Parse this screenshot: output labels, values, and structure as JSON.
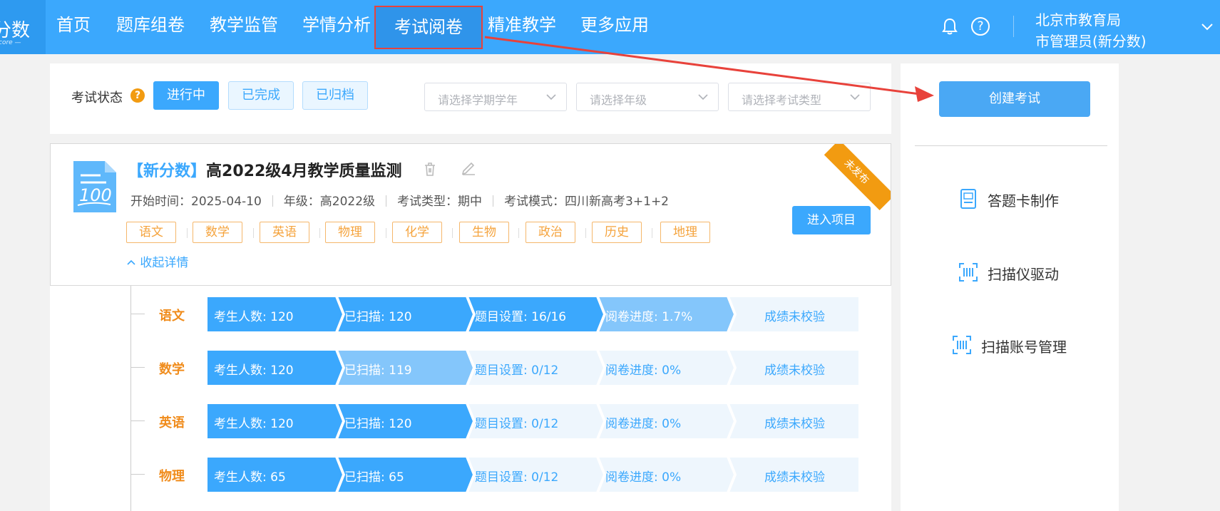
{
  "logo": {
    "text": "分数",
    "sub": "core —"
  },
  "nav": {
    "items": [
      "首页",
      "题库组卷",
      "教学监管",
      "学情分析",
      "考试阅卷",
      "精准教学",
      "更多应用"
    ],
    "active_index": 4,
    "user_org": "北京市教育局",
    "user_role": "市管理员(新分数)"
  },
  "filter": {
    "status_label": "考试状态",
    "help_glyph": "?",
    "buttons": [
      "进行中",
      "已完成",
      "已归档"
    ],
    "active_button": 0,
    "selects": [
      "请选择学期学年",
      "请选择年级",
      "请选择考试类型"
    ]
  },
  "right_panel": {
    "create_label": "创建考试",
    "tools": [
      "答题卡制作",
      "扫描仪驱动",
      "扫描账号管理"
    ]
  },
  "exam": {
    "tag": "【新分数】",
    "title": "高2022级4月教学质量监测",
    "ribbon": "未发布",
    "meta": {
      "start": "开始时间：2025-04-10",
      "grade": "年级：高2022级",
      "type": "考试类型：期中",
      "mode": "考试模式：四川新高考3+1+2"
    },
    "subjects": [
      "语文",
      "数学",
      "英语",
      "物理",
      "化学",
      "生物",
      "政治",
      "历史",
      "地理"
    ],
    "collapse_label": "收起详情",
    "enter_label": "进入项目"
  },
  "progress_rows": [
    {
      "subject": "语文",
      "cells": [
        "考生人数: 120",
        "已扫描: 120",
        "题目设置: 16/16",
        "阅卷进度: 1.7%",
        "成绩未校验"
      ],
      "states": [
        "full",
        "full",
        "full",
        "partial",
        "empty"
      ]
    },
    {
      "subject": "数学",
      "cells": [
        "考生人数: 120",
        "已扫描: 119",
        "题目设置: 0/12",
        "阅卷进度: 0%",
        "成绩未校验"
      ],
      "states": [
        "full",
        "partial",
        "empty",
        "empty",
        "empty"
      ]
    },
    {
      "subject": "英语",
      "cells": [
        "考生人数: 120",
        "已扫描: 120",
        "题目设置: 0/12",
        "阅卷进度: 0%",
        "成绩未校验"
      ],
      "states": [
        "full",
        "full",
        "empty",
        "empty",
        "empty"
      ]
    },
    {
      "subject": "物理",
      "cells": [
        "考生人数: 65",
        "已扫描: 65",
        "题目设置: 0/12",
        "阅卷进度: 0%",
        "成绩未校验"
      ],
      "states": [
        "full",
        "full",
        "empty",
        "empty",
        "empty"
      ]
    }
  ],
  "colors": {
    "full": "#3ba8fd",
    "partial": "#84c6fb",
    "empty": "#eef6fd",
    "highlight": "#e8423b"
  }
}
